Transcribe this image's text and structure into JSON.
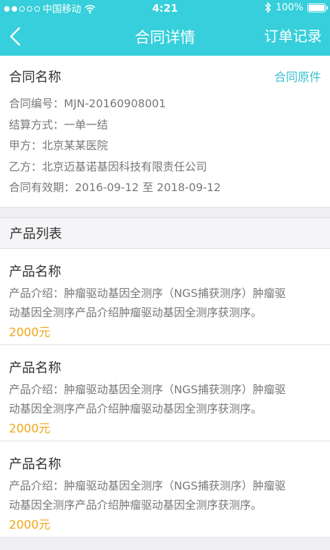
{
  "status_bar": {
    "carrier": "中国移动",
    "time": "4:21",
    "battery": "100%",
    "signal_icon": "signal-dots-icon",
    "wifi_icon": "wifi-icon",
    "bluetooth_icon": "bluetooth-icon",
    "battery_icon": "battery-icon"
  },
  "nav": {
    "title": "合同详情",
    "right_action": "订单记录",
    "back_icon": "chevron-left-icon"
  },
  "contract": {
    "name": "合同名称",
    "original_link": "合同原件",
    "fields": [
      "合同编号：MJN-20160908001",
      "结算方式：一单一结",
      "甲方：北京某某医院",
      "乙方：北京迈基诺基因科技有限责任公司",
      "合同有效期：2016-09-12 至 2018-09-12"
    ]
  },
  "product_section": {
    "title": "产品列表",
    "items": [
      {
        "name": "产品名称",
        "desc_line1": "产品介绍：肿瘤驱动基因全测序（NGS捕获测序）肿瘤驱",
        "desc_line2": "动基因全测序产品介绍肿瘤驱动基因全测序获测序。",
        "price": "2000元"
      },
      {
        "name": "产品名称",
        "desc_line1": "产品介绍：肿瘤驱动基因全测序（NGS捕获测序）肿瘤驱",
        "desc_line2": "动基因全测序产品介绍肿瘤驱动基因全测序获测序。",
        "price": "2000元"
      },
      {
        "name": "产品名称",
        "desc_line1": "产品介绍：肿瘤驱动基因全测序（NGS捕获测序）肿瘤驱",
        "desc_line2": "动基因全测序产品介绍肿瘤驱动基因全测序获测序。",
        "price": "2000元"
      }
    ]
  },
  "colors": {
    "header": "#36cfdb",
    "link": "#36bfd0",
    "price": "#f0a71a",
    "background": "#efeff4"
  }
}
